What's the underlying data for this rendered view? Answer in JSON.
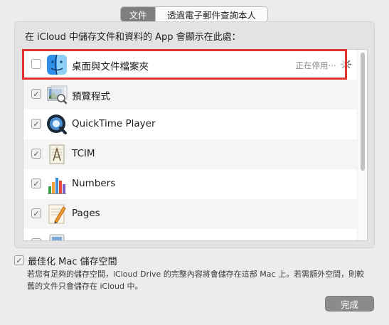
{
  "tabs": [
    {
      "label": "文件",
      "active": true
    },
    {
      "label": "透過電子郵件查詢本人",
      "active": false
    }
  ],
  "panel": {
    "description": "在 iCloud 中儲存文件和資料的 App 會顯示在此處："
  },
  "apps": [
    {
      "name": "桌面與文件檔案夾",
      "checked": false,
      "status": "正在停用⋯",
      "icon": "finder-icon"
    },
    {
      "name": "預覽程式",
      "checked": true,
      "icon": "preview-icon"
    },
    {
      "name": "QuickTime Player",
      "checked": true,
      "icon": "quicktime-icon"
    },
    {
      "name": "TCIM",
      "checked": true,
      "icon": "tcim-icon"
    },
    {
      "name": "Numbers",
      "checked": true,
      "icon": "numbers-icon"
    },
    {
      "name": "Pages",
      "checked": true,
      "icon": "pages-icon"
    },
    {
      "name": "",
      "checked": true,
      "icon": "partial-app-icon"
    }
  ],
  "optimize": {
    "label": "最佳化 Mac 儲存空間",
    "checked": true,
    "description": "若您有足夠的儲存空間，iCloud Drive 的完整內容將會儲存在這部 Mac 上。若需額外空間，則較舊的文件只會儲存在 iCloud 中。"
  },
  "buttons": {
    "done": "完成"
  },
  "colors": {
    "highlight": "#e0322f",
    "active_tab": "#7f7f7f",
    "done_button": "#8b8b8b"
  }
}
